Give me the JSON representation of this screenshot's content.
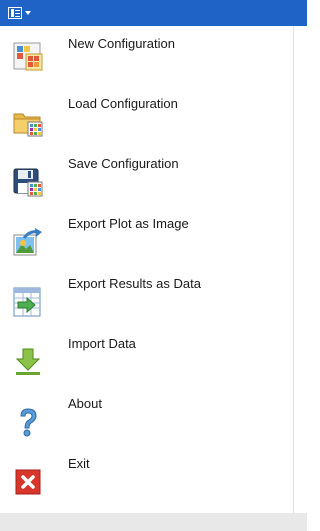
{
  "menu": {
    "items": [
      {
        "label": "New Configuration",
        "icon": "new-configuration-icon"
      },
      {
        "label": "Load Configuration",
        "icon": "folder-grid-icon"
      },
      {
        "label": "Save Configuration",
        "icon": "floppy-disk-icon"
      },
      {
        "label": "Export Plot as Image",
        "icon": "export-image-icon"
      },
      {
        "label": "Export Results as Data",
        "icon": "export-table-icon"
      },
      {
        "label": "Import Data",
        "icon": "download-arrow-icon"
      },
      {
        "label": "About",
        "icon": "question-mark-icon"
      },
      {
        "label": "Exit",
        "icon": "close-icon"
      }
    ]
  },
  "colors": {
    "titlebar": "#1f63c7",
    "text": "#1a1a1a",
    "footer": "#e8e8e8"
  }
}
